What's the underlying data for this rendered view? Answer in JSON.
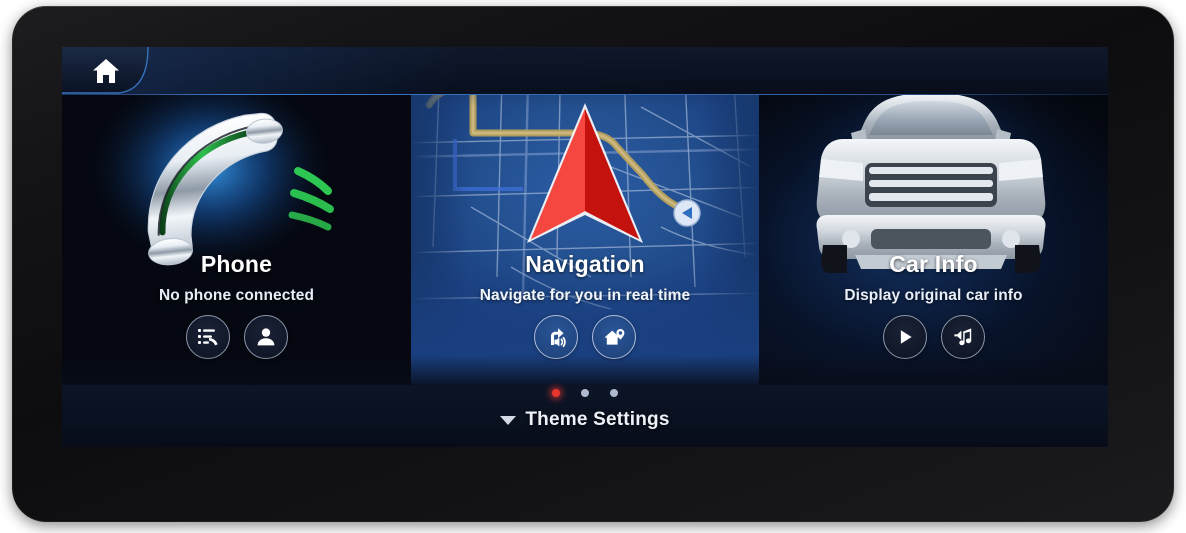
{
  "device": {
    "type": "car-head-unit-touchscreen",
    "bezel_color": "#141416",
    "screen_bg": "#05070c"
  },
  "topbar": {
    "home_icon": "home-icon",
    "home_label": "Home"
  },
  "panels": [
    {
      "id": "phone",
      "title": "Phone",
      "subtitle": "No phone connected",
      "artwork": "glowing-telephone-handset",
      "buttons": [
        {
          "icon": "call-log-icon",
          "label": "Call log"
        },
        {
          "icon": "contacts-icon",
          "label": "Contacts"
        }
      ]
    },
    {
      "id": "navigation",
      "title": "Navigation",
      "subtitle": "Navigate for you in real time",
      "artwork": "map-with-red-navigation-arrow",
      "buttons": [
        {
          "icon": "voice-guidance-icon",
          "label": "Voice guidance"
        },
        {
          "icon": "home-destination-icon",
          "label": "Home destination"
        }
      ]
    },
    {
      "id": "car-info",
      "title": "Car Info",
      "subtitle": "Display original car info",
      "artwork": "silver-suv-front-view",
      "buttons": [
        {
          "icon": "play-icon",
          "label": "Play"
        },
        {
          "icon": "music-note-icon",
          "label": "Music"
        }
      ]
    }
  ],
  "pager": {
    "total": 3,
    "active_index": 0,
    "active_color": "#e8352e",
    "inactive_color": "#aebad0"
  },
  "theme_bar": {
    "caret_icon": "chevron-down-icon",
    "label": "Theme Settings"
  },
  "colors": {
    "accent_blue": "#1b4285",
    "nav_panel": "#1d4487",
    "dark_navy": "#05080f",
    "text_primary": "#ffffff",
    "text_secondary": "#e8eef8",
    "red": "#e8352e"
  }
}
